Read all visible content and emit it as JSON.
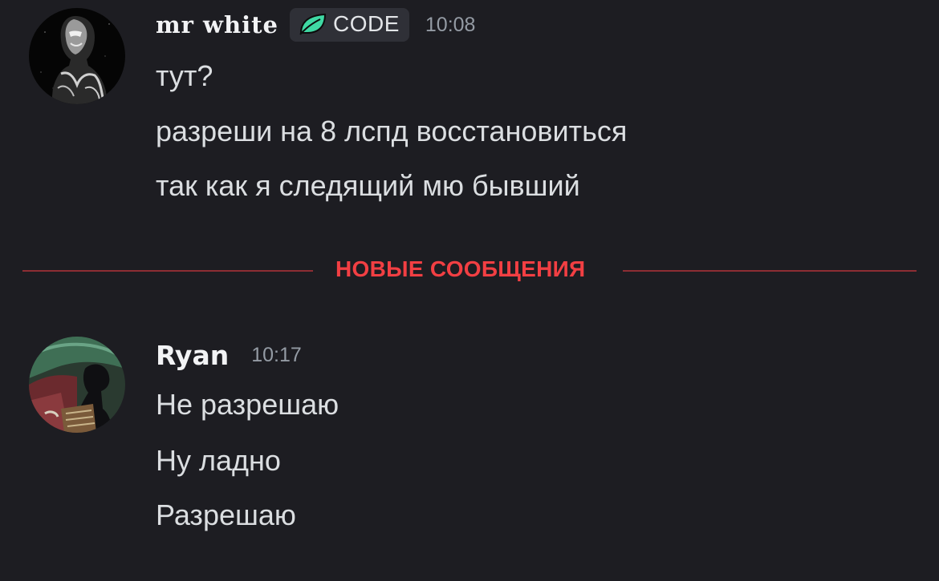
{
  "messages": [
    {
      "author": "mr white",
      "tag": {
        "icon": "leaf-icon",
        "label": "CODE",
        "color": "#3fd9a4"
      },
      "time": "10:08",
      "lines": [
        "тут?",
        "разреши на 8 лспд восстановиться",
        "так как я следящий мю бывший"
      ]
    },
    {
      "author": "Ryan",
      "time": "10:17",
      "lines": [
        "Не разрешаю",
        "Ну ладно",
        "Разрешаю"
      ]
    }
  ],
  "divider": {
    "label": "НОВЫЕ СООБЩЕНИЯ",
    "color": "#f23f43"
  }
}
